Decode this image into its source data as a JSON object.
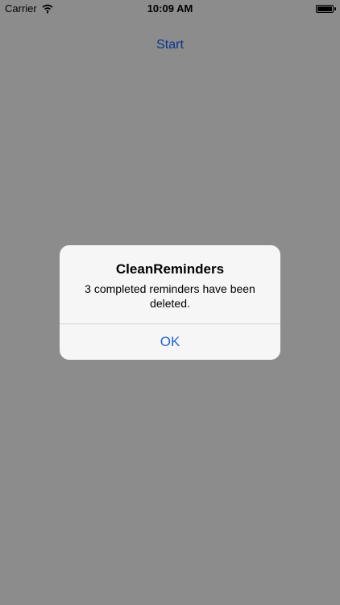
{
  "status_bar": {
    "carrier": "Carrier",
    "time": "10:09 AM",
    "icons": {
      "wifi": "wifi-icon",
      "battery": "battery-icon"
    }
  },
  "main": {
    "start_label": "Start"
  },
  "alert": {
    "title": "CleanReminders",
    "message": "3 completed reminders have been deleted.",
    "ok_label": "OK"
  },
  "colors": {
    "background": "#ffffff",
    "overlay": "rgba(0,0,0,0.45)",
    "alert_background": "#f6f6f6",
    "accent_blue": "#1f64d8"
  }
}
